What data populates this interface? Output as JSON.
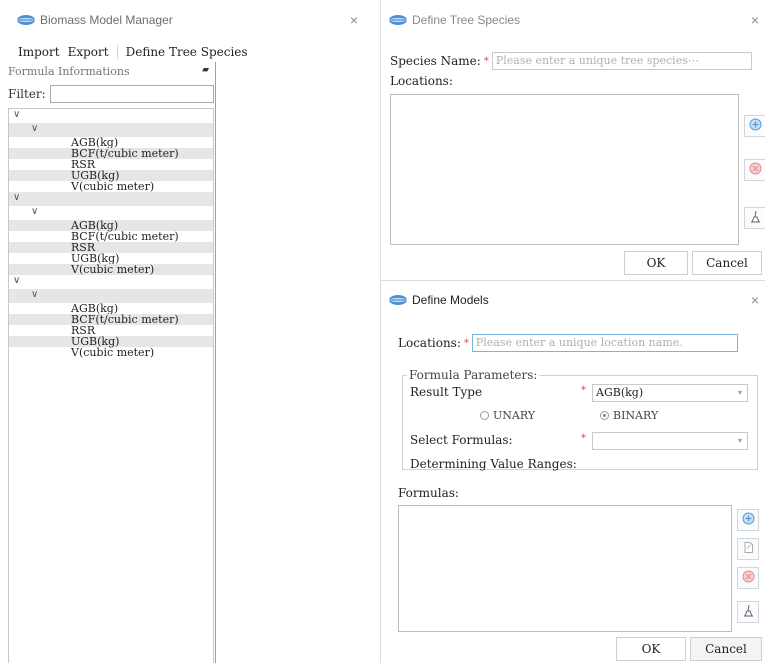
{
  "manager": {
    "title": "Biomass Model Manager",
    "close": "×",
    "menu": [
      "Import",
      "Export",
      "Define Tree Species"
    ],
    "formula_header": "Formula Informations",
    "pin_glyph": "▰",
    "filter_label": "Filter:",
    "filter_value": "",
    "tree": [
      {
        "group_chevron": "∨",
        "sub_chevron": "∨",
        "leaves": [
          "AGB(kg)",
          "BCF(t/cubic meter)",
          "RSR",
          "UGB(kg)",
          "V(cubic meter)"
        ]
      },
      {
        "group_chevron": "∨",
        "sub_chevron": "∨",
        "leaves": [
          "AGB(kg)",
          "BCF(t/cubic meter)",
          "RSR",
          "UGB(kg)",
          "V(cubic meter)"
        ]
      },
      {
        "group_chevron": "∨",
        "sub_chevron": "∨",
        "leaves": [
          "AGB(kg)",
          "BCF(t/cubic meter)",
          "RSR",
          "UGB(kg)",
          "V(cubic meter)"
        ]
      }
    ]
  },
  "species_dialog": {
    "title": "Define Tree Species",
    "close": "×",
    "species_name_label": "Species Name:",
    "required_mark": "*",
    "species_name_placeholder": "Please enter a unique tree species⋯",
    "locations_label": "Locations:",
    "ok": "OK",
    "cancel": "Cancel"
  },
  "models_dialog": {
    "title": "Define Models",
    "close": "×",
    "locations_label": "Locations:",
    "required_mark": "*",
    "locations_placeholder": "Please enter a unique location name.",
    "params_legend": "Formula Parameters:",
    "result_type_label": "Result Type",
    "result_type_value": "AGB(kg)",
    "radio_unary": "UNARY",
    "radio_binary": "BINARY",
    "select_formulas_label": "Select Formulas:",
    "select_formulas_value": "",
    "value_ranges_label": "Determining Value Ranges:",
    "formulas_label": "Formulas:",
    "ok": "OK",
    "cancel": "Cancel"
  },
  "colors": {
    "accent_blue": "#5b9bd5",
    "required_red": "#e04a4a",
    "alt_row_gray": "#e6e6e6"
  },
  "icons": {
    "app": "globe-logo-icon",
    "add": "plus-circle-icon",
    "remove": "minus-circle-icon",
    "clear": "broom-icon",
    "edit": "document-edit-icon"
  }
}
